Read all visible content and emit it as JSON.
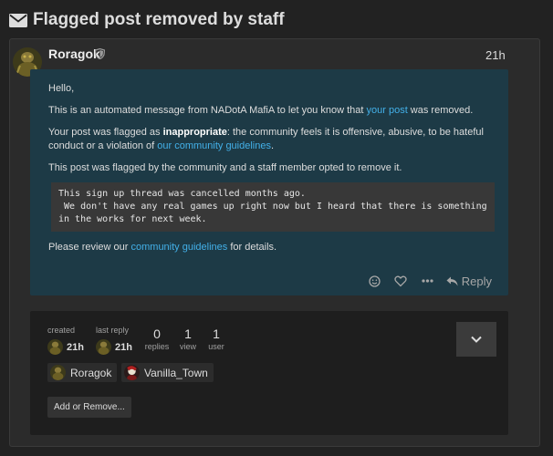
{
  "title": "Flagged post removed by staff",
  "post": {
    "username": "Roragok",
    "date": "21h",
    "hello": "Hello,",
    "auto_prefix": "This is an automated message from NADotA MafiA to let you know that ",
    "auto_link": "your post",
    "auto_suffix": " was removed.",
    "flag_prefix": "Your post was flagged as ",
    "flag_bold": "inappropriate",
    "flag_mid": ": the community feels it is offensive, abusive, to be hateful conduct or a violation of ",
    "flag_link": "our community guidelines",
    "flag_suffix": ".",
    "community_text": "This post was flagged by the community and a staff member opted to remove it.",
    "code": "This sign up thread was cancelled months ago.\n We don't have any real games up right now but I heard that there is something in the works for next week.",
    "review_prefix": "Please review our ",
    "review_link": "community guidelines",
    "review_suffix": " for details.",
    "reply_label": "Reply"
  },
  "topic_map": {
    "created_label": "created",
    "created_value": "21h",
    "last_reply_label": "last reply",
    "last_reply_value": "21h",
    "replies_count": "0",
    "replies_label": "replies",
    "views_count": "1",
    "views_label": "view",
    "users_count": "1",
    "users_label": "user",
    "participants": [
      "Roragok",
      "Vanilla_Town"
    ],
    "add_remove_label": "Add or Remove..."
  },
  "colors": {
    "link": "#43b0e8",
    "post_bg": "#1d3a46",
    "page_bg": "#222222"
  }
}
